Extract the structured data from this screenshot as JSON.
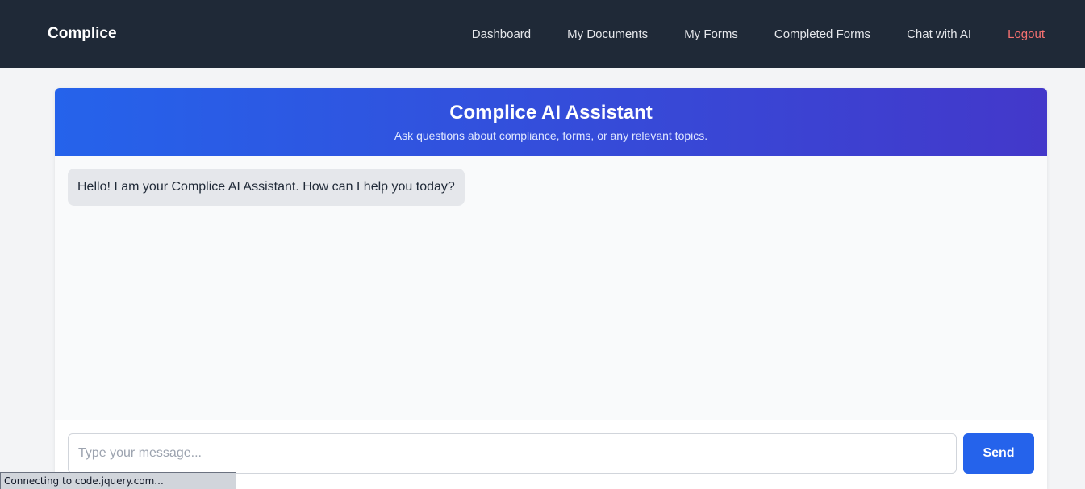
{
  "navbar": {
    "brand": "Complice",
    "links": [
      {
        "label": "Dashboard"
      },
      {
        "label": "My Documents"
      },
      {
        "label": "My Forms"
      },
      {
        "label": "Completed Forms"
      },
      {
        "label": "Chat with AI"
      },
      {
        "label": "Logout"
      }
    ]
  },
  "chat": {
    "title": "Complice AI Assistant",
    "subtitle": "Ask questions about compliance, forms, or any relevant topics.",
    "messages": [
      {
        "sender": "bot",
        "text": "Hello! I am your Complice AI Assistant. How can I help you today?"
      }
    ],
    "input": {
      "placeholder": "Type your message...",
      "value": ""
    },
    "send_label": "Send"
  },
  "browser_status": "Connecting to code.jquery.com...",
  "colors": {
    "navbar_bg": "#1f2937",
    "accent": "#2563eb",
    "gradient_end": "#4338ca",
    "logout": "#f87171"
  }
}
